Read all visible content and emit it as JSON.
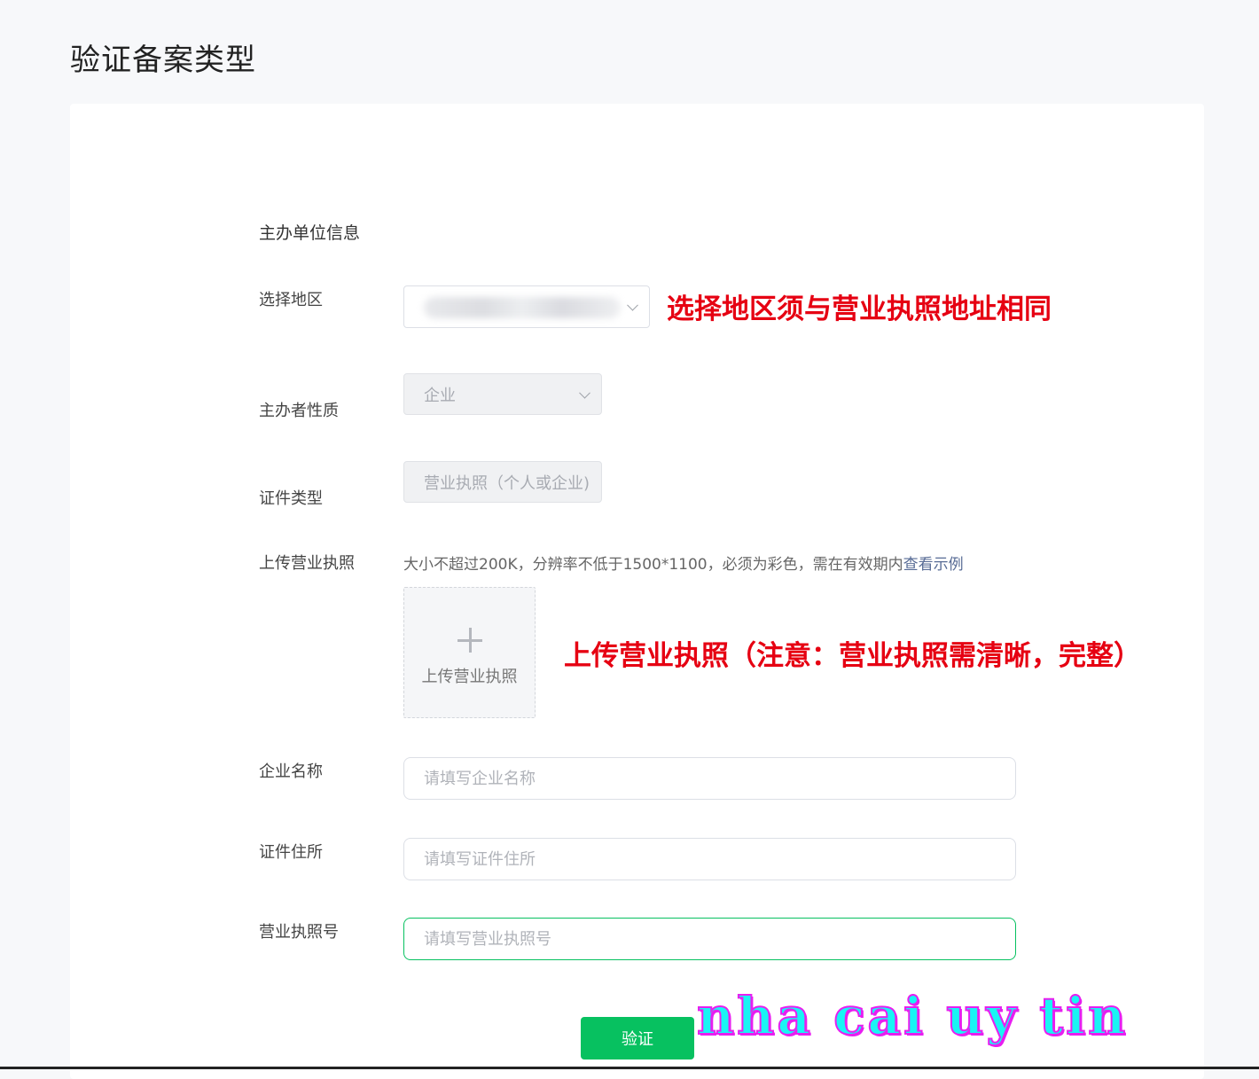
{
  "page": {
    "title": "验证备案类型"
  },
  "section": {
    "title": "主办单位信息"
  },
  "region": {
    "label": "选择地区",
    "annotation": "选择地区须与营业执照地址相同"
  },
  "nature": {
    "label": "主办者性质",
    "value": "企业"
  },
  "cert_type": {
    "label": "证件类型",
    "value": "营业执照（个人或企业)"
  },
  "upload": {
    "label": "上传营业执照",
    "hint": "大小不超过200K，分辨率不低于1500*1100，必须为彩色，需在有效期内",
    "example_link": "查看示例",
    "button_text": "上传营业执照",
    "annotation": "上传营业执照（注意：营业执照需清晰，完整）"
  },
  "company_name": {
    "label": "企业名称",
    "placeholder": "请填写企业名称"
  },
  "address": {
    "label": "证件住所",
    "placeholder": "请填写证件住所"
  },
  "license_no": {
    "label": "营业执照号",
    "placeholder": "请填写营业执照号"
  },
  "verify_button": "验证",
  "watermark": "nha cai uy tin",
  "colors": {
    "accent": "#07c160",
    "annotation": "#e60012",
    "link": "#576b95"
  }
}
